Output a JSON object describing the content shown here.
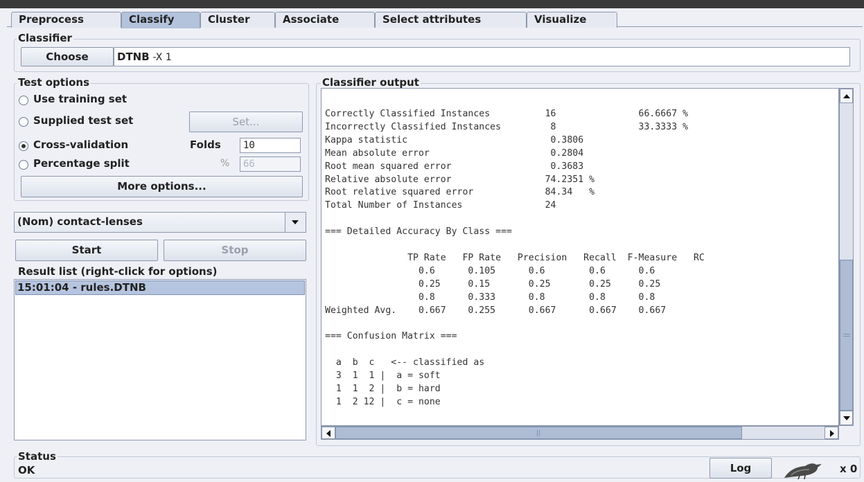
{
  "tabs": [
    {
      "label": "Preprocess"
    },
    {
      "label": "Classify"
    },
    {
      "label": "Cluster"
    },
    {
      "label": "Associate"
    },
    {
      "label": "Select attributes"
    },
    {
      "label": "Visualize"
    }
  ],
  "active_tab": "Classify",
  "classifier": {
    "group_label": "Classifier",
    "choose_label": "Choose",
    "name": "DTNB",
    "options": "-X 1"
  },
  "test_options": {
    "group_label": "Test options",
    "use_training_set": "Use training set",
    "supplied_test_set": "Supplied test set",
    "set_button": "Set...",
    "cross_validation": "Cross-validation",
    "folds_label": "Folds",
    "folds_value": "10",
    "percentage_split": "Percentage split",
    "percent_symbol": "%",
    "percent_value": "66",
    "selected": "Cross-validation",
    "more_options": "More options..."
  },
  "class_attribute": "(Nom) contact-lenses",
  "run": {
    "start": "Start",
    "stop": "Stop"
  },
  "result_list": {
    "label": "Result list (right-click for options)",
    "items": [
      "15:01:04 - rules.DTNB"
    ]
  },
  "output": {
    "label": "Classifier output",
    "text": "Correctly Classified Instances          16               66.6667 %\nIncorrectly Classified Instances         8               33.3333 %\nKappa statistic                          0.3806\nMean absolute error                      0.2804\nRoot mean squared error                  0.3683\nRelative absolute error                 74.2351 %\nRoot relative squared error             84.34   %\nTotal Number of Instances               24     \n\n=== Detailed Accuracy By Class ===\n\n               TP Rate   FP Rate   Precision   Recall  F-Measure   RC\n                 0.6      0.105      0.6        0.6      0.6    \n                 0.25     0.15       0.25       0.25     0.25   \n                 0.8      0.333      0.8        0.8      0.8    \nWeighted Avg.    0.667    0.255      0.667      0.667    0.667  \n\n=== Confusion Matrix ===\n\n  a  b  c   <-- classified as\n  3  1  1 |  a = soft\n  1  1  2 |  b = hard\n  1  2 12 |  c = none"
  },
  "status": {
    "label": "Status",
    "text": "OK",
    "log_button": "Log",
    "count": "x 0"
  }
}
